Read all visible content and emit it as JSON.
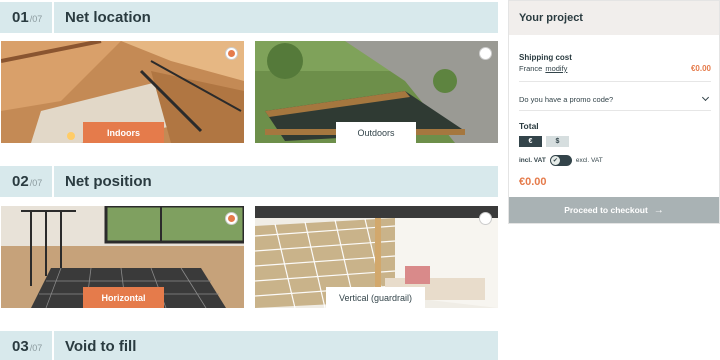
{
  "steps": [
    {
      "num": "01",
      "total": "/07",
      "title": "Net location",
      "options": [
        {
          "label": "Indoors",
          "selected": true
        },
        {
          "label": "Outdoors",
          "selected": false
        }
      ]
    },
    {
      "num": "02",
      "total": "/07",
      "title": "Net position",
      "options": [
        {
          "label": "Horizontal",
          "selected": true
        },
        {
          "label": "Vertical (guardrail)",
          "selected": false
        }
      ]
    },
    {
      "num": "03",
      "total": "/07",
      "title": "Void to fill"
    }
  ],
  "project": {
    "title": "Your project",
    "shipping_label": "Shipping cost",
    "shipping_country": "France",
    "modify_label": "modify",
    "shipping_price": "€0.00",
    "promo_label": "Do you have a promo code?",
    "total_label": "Total",
    "currencies": [
      "€",
      "$"
    ],
    "selected_currency": "€",
    "vat_incl_label": "incl. VAT",
    "vat_excl_label": "excl. VAT",
    "vat_toggle_icon": "check-icon",
    "total_price": "€0.00",
    "checkout_label": "Proceed to checkout",
    "checkout_icon": "arrow-right-icon"
  },
  "colors": {
    "accent": "#e57b4b",
    "header_bg": "#d8e9ec",
    "panel_head_bg": "#f1eeec",
    "checkout_bg": "#a9b2b4",
    "dark": "#33444a"
  }
}
